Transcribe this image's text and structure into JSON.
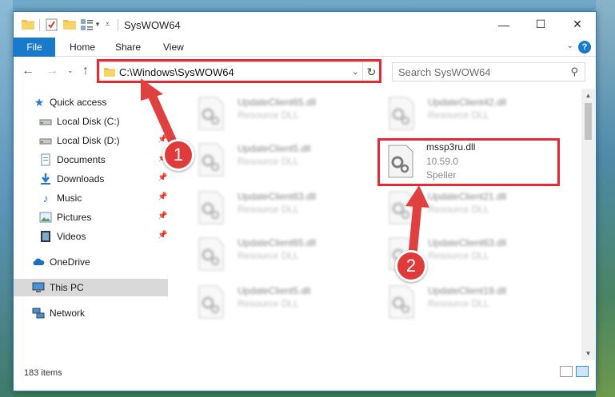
{
  "window": {
    "title": "SysWOW64",
    "minimize_symbol": "—",
    "maximize_symbol": "☐",
    "close_symbol": "✕"
  },
  "ribbon": {
    "file": "File",
    "home": "Home",
    "share": "Share",
    "view": "View",
    "help_symbol": "?"
  },
  "navbar": {
    "address": "C:\\Windows\\SysWOW64",
    "search_placeholder": "Search SysWOW64"
  },
  "sidebar": {
    "items": [
      {
        "label": "Quick access",
        "icon": "star-icon",
        "pinned": false
      },
      {
        "label": "Local Disk (C:)",
        "icon": "drive-icon",
        "pinned": true
      },
      {
        "label": "Local Disk (D:)",
        "icon": "drive-icon",
        "pinned": true
      },
      {
        "label": "Documents",
        "icon": "documents-icon",
        "pinned": true
      },
      {
        "label": "Downloads",
        "icon": "downloads-icon",
        "pinned": true
      },
      {
        "label": "Music",
        "icon": "music-icon",
        "pinned": true
      },
      {
        "label": "Pictures",
        "icon": "pictures-icon",
        "pinned": true
      },
      {
        "label": "Videos",
        "icon": "videos-icon",
        "pinned": true
      },
      {
        "label": "OneDrive",
        "icon": "cloud-icon",
        "pinned": false
      },
      {
        "label": "This PC",
        "icon": "computer-icon",
        "pinned": false,
        "selected": true
      },
      {
        "label": "Network",
        "icon": "network-icon",
        "pinned": false
      }
    ]
  },
  "files": [
    {
      "name": "UpdateClient65.dll",
      "desc": "Resource DLL",
      "blurred": true
    },
    {
      "name": "UpdateClient42.dll",
      "desc": "Resource DLL",
      "blurred": true
    },
    {
      "name": "UpdateClient5.dll",
      "desc": "Resource DLL",
      "blurred": true
    },
    {
      "name": "mssp3ru.dll",
      "version": "10.59.0",
      "desc": "Speller",
      "blurred": false,
      "highlighted": true
    },
    {
      "name": "UpdateClient63.dll",
      "desc": "Resource DLL",
      "blurred": true
    },
    {
      "name": "UpdateClient21.dll",
      "desc": "Resource DLL",
      "blurred": true
    },
    {
      "name": "UpdateClient65.dll",
      "desc": "Resource DLL",
      "blurred": true
    },
    {
      "name": "UpdateClient63.dll",
      "desc": "Resource DLL",
      "blurred": true
    },
    {
      "name": "UpdateClient5.dll",
      "desc": "Resource DLL",
      "blurred": true
    },
    {
      "name": "UpdateClient19.dll",
      "desc": "Resource DLL",
      "blurred": true
    }
  ],
  "status": {
    "item_count": "183 items"
  },
  "callouts": {
    "step1": "1",
    "step2": "2"
  },
  "colors": {
    "accent": "#1979ca",
    "highlight": "#e52a36",
    "callout": "#df3b3b"
  }
}
